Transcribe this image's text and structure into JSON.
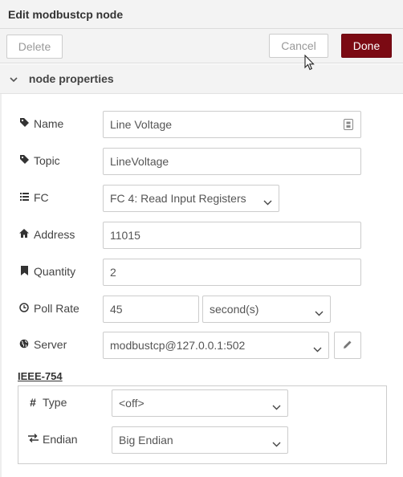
{
  "title": "Edit modbustcp node",
  "toolbar": {
    "delete_label": "Delete",
    "cancel_label": "Cancel",
    "done_label": "Done"
  },
  "section": {
    "title": "node properties"
  },
  "form": {
    "name": {
      "label": "Name",
      "value": "Line Voltage",
      "icon": "tag-icon"
    },
    "topic": {
      "label": "Topic",
      "value": "LineVoltage",
      "icon": "tag-icon"
    },
    "fc": {
      "label": "FC",
      "value": "FC 4: Read Input Registers",
      "icon": "list-icon"
    },
    "address": {
      "label": "Address",
      "value": "11015",
      "icon": "home-icon"
    },
    "quantity": {
      "label": "Quantity",
      "value": "2",
      "icon": "bookmark-icon"
    },
    "poll_rate": {
      "label": "Poll Rate",
      "value": "45",
      "unit": "second(s)",
      "icon": "clock-icon"
    },
    "server": {
      "label": "Server",
      "value": "modbustcp@127.0.0.1:502",
      "icon": "globe-icon"
    }
  },
  "ieee": {
    "title": "IEEE-754",
    "type": {
      "label": "Type",
      "value": "<off>",
      "icon": "hash-icon"
    },
    "endian": {
      "label": "Endian",
      "value": "Big Endian",
      "icon": "swap-icon"
    }
  },
  "colors": {
    "done_button": "#7b0a13",
    "panel_bg": "#f3f3f3",
    "border": "#cccccc"
  }
}
